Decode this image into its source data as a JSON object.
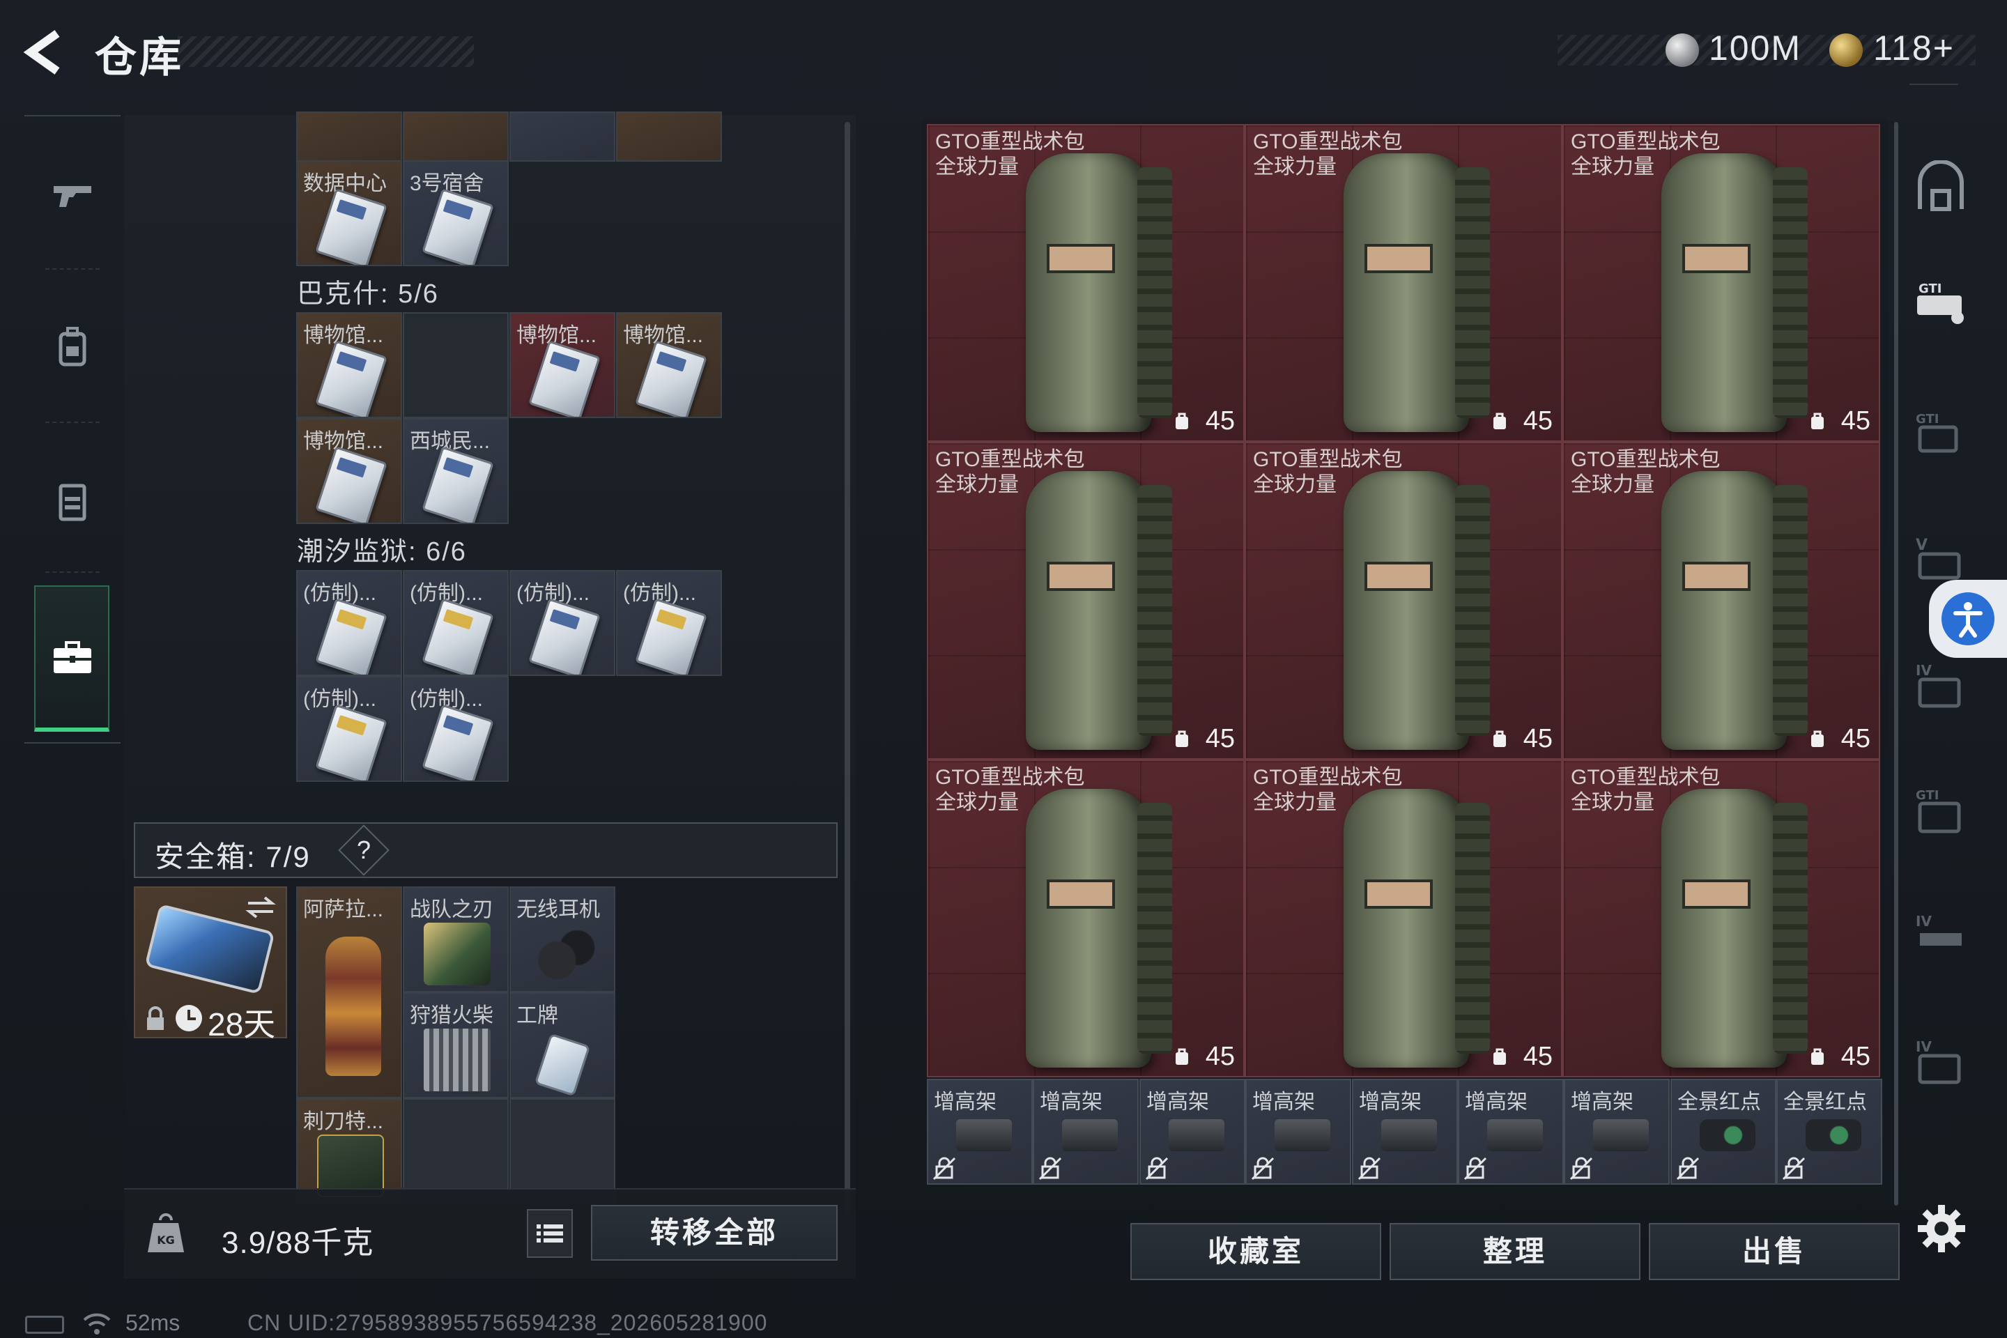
{
  "header": {
    "title": "仓库",
    "currency_silver": "100M",
    "currency_gold": "118+"
  },
  "sidebar": {
    "items": [
      {
        "icon": "gun-icon"
      },
      {
        "icon": "backpack-icon"
      },
      {
        "icon": "vest-icon"
      },
      {
        "icon": "briefcase-icon",
        "active": true
      }
    ]
  },
  "keycards": {
    "top_partial": [
      "",
      "",
      "",
      ""
    ],
    "row_a": [
      "数据中心",
      "3号宿舍"
    ],
    "bakesh_header": "巴克什: 5/6",
    "bakesh_row1": [
      "博物馆...",
      "",
      "博物馆...",
      "博物馆..."
    ],
    "bakesh_row2": [
      "博物馆...",
      "西城民..."
    ],
    "prison_header": "潮汐监狱: 6/6",
    "prison_row1": [
      "(仿制)...",
      "(仿制)...",
      "(仿制)...",
      "(仿制)..."
    ],
    "prison_row2": [
      "(仿制)...",
      "(仿制)..."
    ]
  },
  "safe": {
    "title": "安全箱: 7/9",
    "help": "?",
    "days": "28天",
    "items": [
      {
        "label": "阿萨拉..."
      },
      {
        "label": "战队之刃"
      },
      {
        "label": "无线耳机"
      },
      {
        "label": "狩猎火柴"
      },
      {
        "label": "工牌"
      },
      {
        "label": "刺刀特..."
      }
    ]
  },
  "weight_bar": {
    "weight": "3.9/88千克",
    "transfer_all": "转移全部"
  },
  "storage": {
    "bags": [
      {
        "name": "GTO重型战术包\n全球力量",
        "capacity": "45"
      },
      {
        "name": "GTO重型战术包\n全球力量",
        "capacity": "45"
      },
      {
        "name": "GTO重型战术包\n全球力量",
        "capacity": "45"
      },
      {
        "name": "GTO重型战术包\n全球力量",
        "capacity": "45"
      },
      {
        "name": "GTO重型战术包\n全球力量",
        "capacity": "45"
      },
      {
        "name": "GTO重型战术包\n全球力量",
        "capacity": "45"
      },
      {
        "name": "GTO重型战术包\n全球力量",
        "capacity": "45"
      },
      {
        "name": "GTO重型战术包\n全球力量",
        "capacity": "45"
      },
      {
        "name": "GTO重型战术包\n全球力量",
        "capacity": "45"
      }
    ],
    "mounts": [
      "增高架",
      "增高架",
      "增高架",
      "增高架",
      "增高架",
      "增高架",
      "增高架",
      "全景红点",
      "全景红点"
    ]
  },
  "bottom_tabs": {
    "collection": "收藏室",
    "organize": "整理",
    "sell": "出售"
  },
  "footer": {
    "ping": "52ms",
    "uid": "CN UID:27958938955756594238_202605281900"
  },
  "colors": {
    "accent_green": "#3fcf85",
    "bag_bg": "#4a2328",
    "accessibility_blue": "#2a6fd6"
  }
}
